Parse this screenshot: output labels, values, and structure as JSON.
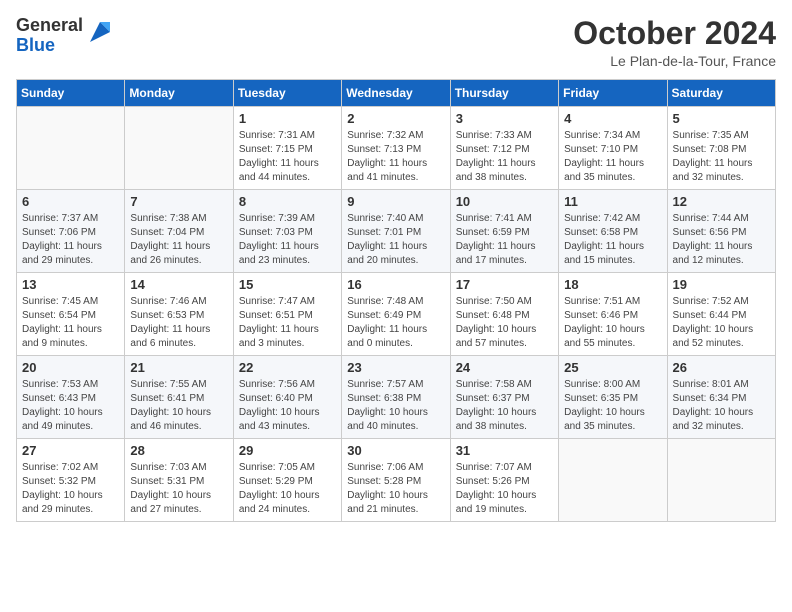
{
  "header": {
    "logo": {
      "general": "General",
      "blue": "Blue"
    },
    "title": "October 2024",
    "location": "Le Plan-de-la-Tour, France"
  },
  "calendar": {
    "days_of_week": [
      "Sunday",
      "Monday",
      "Tuesday",
      "Wednesday",
      "Thursday",
      "Friday",
      "Saturday"
    ],
    "weeks": [
      [
        {
          "day": "",
          "info": ""
        },
        {
          "day": "",
          "info": ""
        },
        {
          "day": "1",
          "info": "Sunrise: 7:31 AM\nSunset: 7:15 PM\nDaylight: 11 hours and 44 minutes."
        },
        {
          "day": "2",
          "info": "Sunrise: 7:32 AM\nSunset: 7:13 PM\nDaylight: 11 hours and 41 minutes."
        },
        {
          "day": "3",
          "info": "Sunrise: 7:33 AM\nSunset: 7:12 PM\nDaylight: 11 hours and 38 minutes."
        },
        {
          "day": "4",
          "info": "Sunrise: 7:34 AM\nSunset: 7:10 PM\nDaylight: 11 hours and 35 minutes."
        },
        {
          "day": "5",
          "info": "Sunrise: 7:35 AM\nSunset: 7:08 PM\nDaylight: 11 hours and 32 minutes."
        }
      ],
      [
        {
          "day": "6",
          "info": "Sunrise: 7:37 AM\nSunset: 7:06 PM\nDaylight: 11 hours and 29 minutes."
        },
        {
          "day": "7",
          "info": "Sunrise: 7:38 AM\nSunset: 7:04 PM\nDaylight: 11 hours and 26 minutes."
        },
        {
          "day": "8",
          "info": "Sunrise: 7:39 AM\nSunset: 7:03 PM\nDaylight: 11 hours and 23 minutes."
        },
        {
          "day": "9",
          "info": "Sunrise: 7:40 AM\nSunset: 7:01 PM\nDaylight: 11 hours and 20 minutes."
        },
        {
          "day": "10",
          "info": "Sunrise: 7:41 AM\nSunset: 6:59 PM\nDaylight: 11 hours and 17 minutes."
        },
        {
          "day": "11",
          "info": "Sunrise: 7:42 AM\nSunset: 6:58 PM\nDaylight: 11 hours and 15 minutes."
        },
        {
          "day": "12",
          "info": "Sunrise: 7:44 AM\nSunset: 6:56 PM\nDaylight: 11 hours and 12 minutes."
        }
      ],
      [
        {
          "day": "13",
          "info": "Sunrise: 7:45 AM\nSunset: 6:54 PM\nDaylight: 11 hours and 9 minutes."
        },
        {
          "day": "14",
          "info": "Sunrise: 7:46 AM\nSunset: 6:53 PM\nDaylight: 11 hours and 6 minutes."
        },
        {
          "day": "15",
          "info": "Sunrise: 7:47 AM\nSunset: 6:51 PM\nDaylight: 11 hours and 3 minutes."
        },
        {
          "day": "16",
          "info": "Sunrise: 7:48 AM\nSunset: 6:49 PM\nDaylight: 11 hours and 0 minutes."
        },
        {
          "day": "17",
          "info": "Sunrise: 7:50 AM\nSunset: 6:48 PM\nDaylight: 10 hours and 57 minutes."
        },
        {
          "day": "18",
          "info": "Sunrise: 7:51 AM\nSunset: 6:46 PM\nDaylight: 10 hours and 55 minutes."
        },
        {
          "day": "19",
          "info": "Sunrise: 7:52 AM\nSunset: 6:44 PM\nDaylight: 10 hours and 52 minutes."
        }
      ],
      [
        {
          "day": "20",
          "info": "Sunrise: 7:53 AM\nSunset: 6:43 PM\nDaylight: 10 hours and 49 minutes."
        },
        {
          "day": "21",
          "info": "Sunrise: 7:55 AM\nSunset: 6:41 PM\nDaylight: 10 hours and 46 minutes."
        },
        {
          "day": "22",
          "info": "Sunrise: 7:56 AM\nSunset: 6:40 PM\nDaylight: 10 hours and 43 minutes."
        },
        {
          "day": "23",
          "info": "Sunrise: 7:57 AM\nSunset: 6:38 PM\nDaylight: 10 hours and 40 minutes."
        },
        {
          "day": "24",
          "info": "Sunrise: 7:58 AM\nSunset: 6:37 PM\nDaylight: 10 hours and 38 minutes."
        },
        {
          "day": "25",
          "info": "Sunrise: 8:00 AM\nSunset: 6:35 PM\nDaylight: 10 hours and 35 minutes."
        },
        {
          "day": "26",
          "info": "Sunrise: 8:01 AM\nSunset: 6:34 PM\nDaylight: 10 hours and 32 minutes."
        }
      ],
      [
        {
          "day": "27",
          "info": "Sunrise: 7:02 AM\nSunset: 5:32 PM\nDaylight: 10 hours and 29 minutes."
        },
        {
          "day": "28",
          "info": "Sunrise: 7:03 AM\nSunset: 5:31 PM\nDaylight: 10 hours and 27 minutes."
        },
        {
          "day": "29",
          "info": "Sunrise: 7:05 AM\nSunset: 5:29 PM\nDaylight: 10 hours and 24 minutes."
        },
        {
          "day": "30",
          "info": "Sunrise: 7:06 AM\nSunset: 5:28 PM\nDaylight: 10 hours and 21 minutes."
        },
        {
          "day": "31",
          "info": "Sunrise: 7:07 AM\nSunset: 5:26 PM\nDaylight: 10 hours and 19 minutes."
        },
        {
          "day": "",
          "info": ""
        },
        {
          "day": "",
          "info": ""
        }
      ]
    ]
  }
}
